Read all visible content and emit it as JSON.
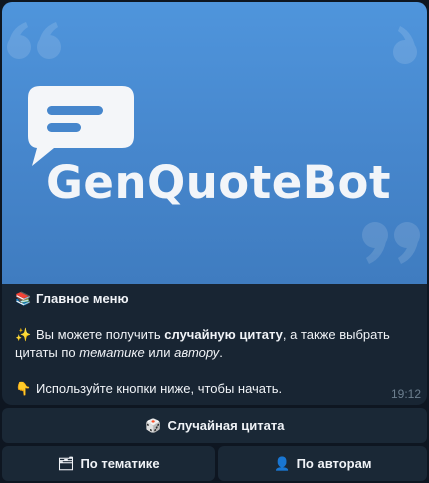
{
  "message": {
    "banner": {
      "brand_name": "GenQuoteBot",
      "icons": [
        "quote-marks-icon",
        "chat-bubble-icon"
      ]
    },
    "lines": {
      "menu_emoji": "📚",
      "menu_title": "Главное меню",
      "intro_emoji": "✨",
      "intro_part1": "Вы можете получить ",
      "intro_bold": "случайную цитату",
      "intro_part2": ", а также выбрать цитаты по ",
      "intro_topic": "тематике",
      "intro_or": " или ",
      "intro_author": "автору",
      "intro_end": ".",
      "hint_emoji": "👇",
      "hint_text": "Используйте кнопки ниже, чтобы начать."
    },
    "time": "19:12"
  },
  "keyboard": {
    "random": {
      "emoji": "🎲",
      "label": "Случайная цитата"
    },
    "topics": {
      "emoji": "🗂",
      "label": "По тематике"
    },
    "authors": {
      "emoji": "👤",
      "label": "По авторам"
    }
  },
  "colors": {
    "background": "#0e1621",
    "bubble": "#182533",
    "banner": "#4686cc",
    "button": "#1a2836",
    "text": "#f0f3f7",
    "time": "#6d7f8f"
  }
}
